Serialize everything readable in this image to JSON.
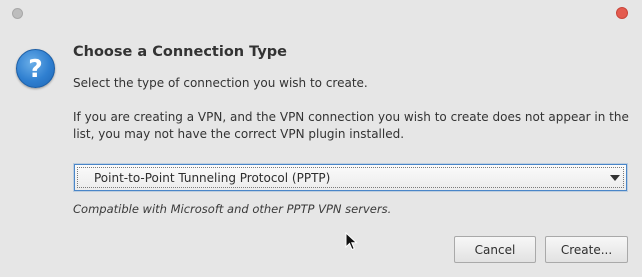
{
  "dialog": {
    "heading": "Choose a Connection Type",
    "subtitle": "Select the type of connection you wish to create.",
    "info": "If you are creating a VPN, and the VPN connection you wish to create does not appear in the list, you may not have the correct VPN plugin installed.",
    "hint": "Compatible with Microsoft and other PPTP VPN servers."
  },
  "connection_select": {
    "selected": "Point-to-Point Tunneling Protocol (PPTP)"
  },
  "buttons": {
    "cancel": "Cancel",
    "create": "Create..."
  },
  "icons": {
    "dialog_icon": "question-icon",
    "dialog_icon_glyph": "?",
    "dropdown": "chevron-down-icon",
    "titlebar_left": "window-menu-icon",
    "titlebar_close": "close-icon",
    "pointer": "mouse-cursor-icon"
  },
  "colors": {
    "background": "#e6e6e6",
    "accent": "#4a86c8",
    "close": "#e45b4f",
    "question_icon": "#2f7fd0"
  }
}
